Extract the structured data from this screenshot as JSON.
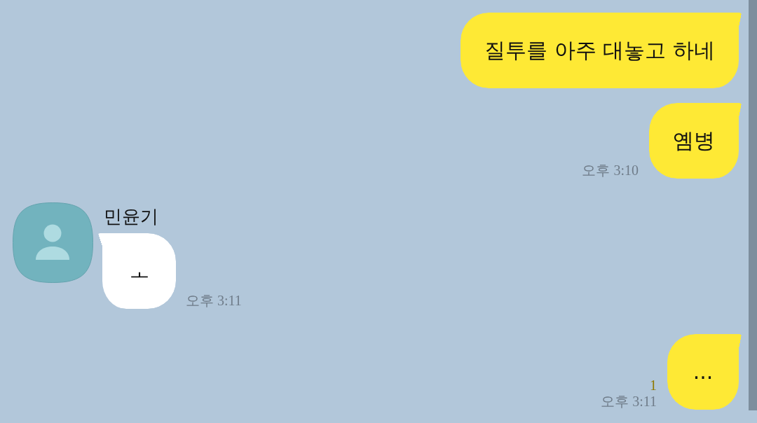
{
  "messages": [
    {
      "kind": "sent",
      "text": "질투를 아주 대놓고 하네"
    },
    {
      "kind": "sent",
      "text": "옘병",
      "time": "오후 3:10"
    },
    {
      "kind": "received",
      "sender": "민윤기",
      "text": "ㅗ",
      "time": "오후 3:11"
    },
    {
      "kind": "sent",
      "text": "...",
      "unread": "1",
      "time": "오후 3:11"
    }
  ]
}
